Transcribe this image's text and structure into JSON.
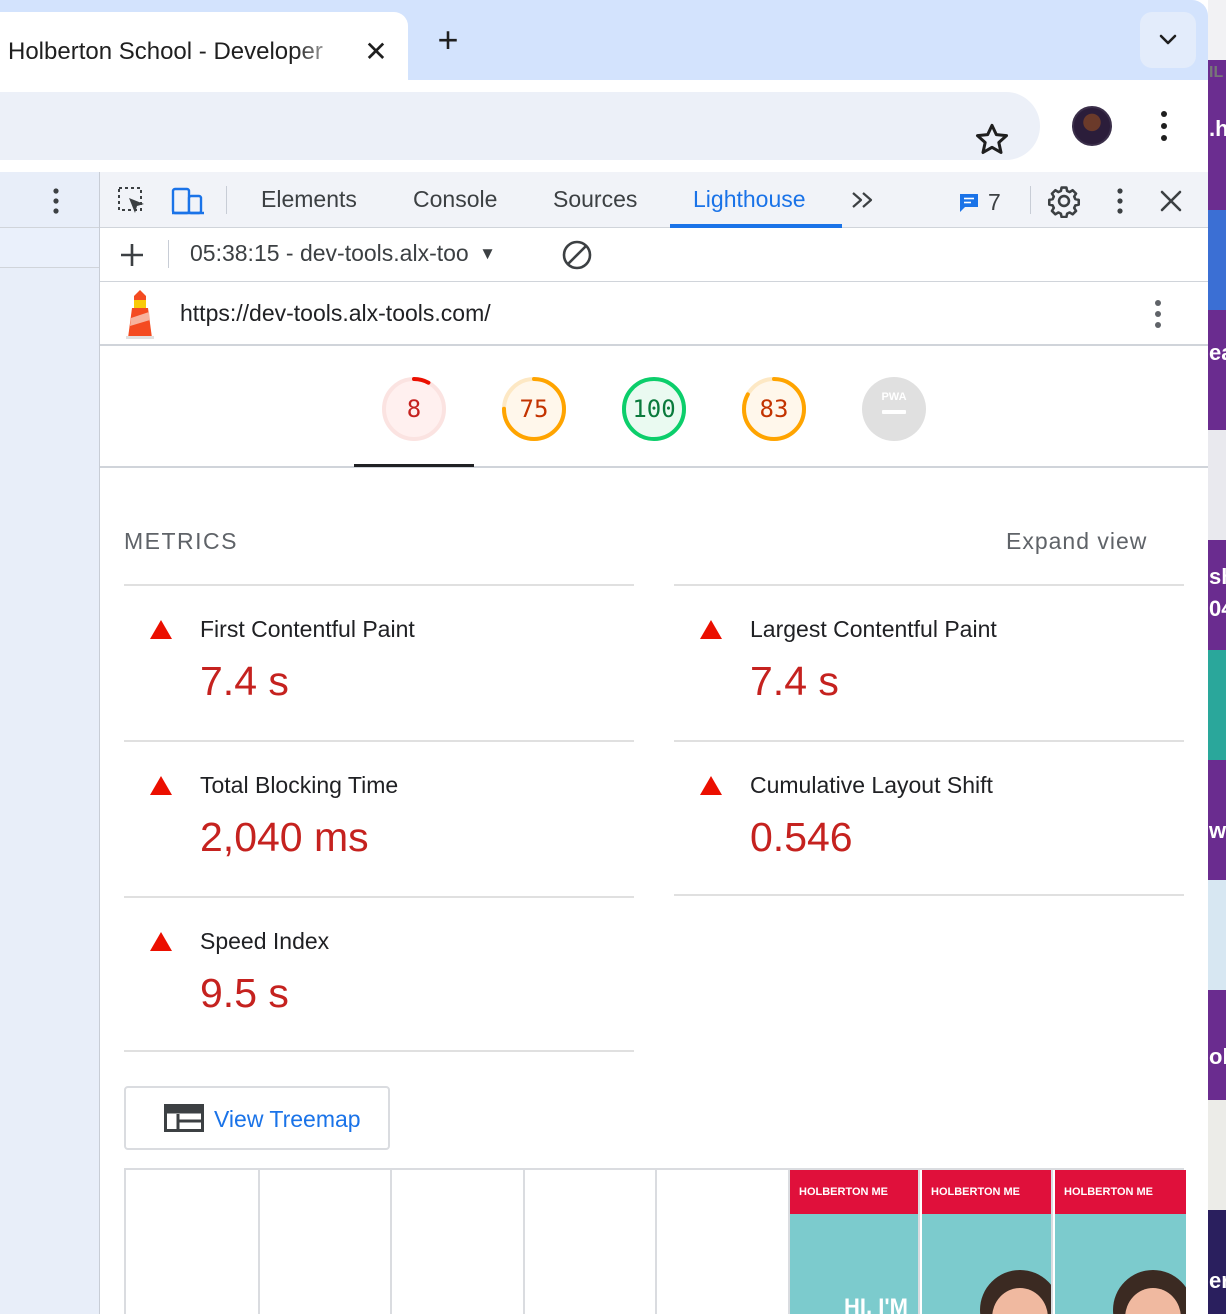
{
  "browser": {
    "tab_title": "Holberton School - Developer",
    "new_tab_symbol": "+",
    "close_symbol": "✕"
  },
  "devtools": {
    "tabs": [
      "Elements",
      "Console",
      "Sources",
      "Lighthouse"
    ],
    "active_tab": "Lighthouse",
    "more_tabs_symbol": "»",
    "issues_count": "7",
    "report_selector": "05:38:15 - dev-tools.alx-too",
    "report_url": "https://dev-tools.alx-tools.com/"
  },
  "scores": [
    {
      "label": "8",
      "value": 8,
      "color": "#eb0f00",
      "bg": "#fff0ef",
      "track": "#fbe3e1"
    },
    {
      "label": "75",
      "value": 75,
      "color": "#ffa400",
      "bg": "#fff7eb",
      "track": "#fde8c4"
    },
    {
      "label": "100",
      "value": 100,
      "color": "#0cce6b",
      "bg": "#eafaf1",
      "track": "#cdf3de"
    },
    {
      "label": "83",
      "value": 83,
      "color": "#ffa400",
      "bg": "#fff7eb",
      "track": "#fde8c4"
    },
    {
      "label": "PWA",
      "value": null,
      "color": "#9e9e9e",
      "bg": "#e0e0e0",
      "track": "#e0e0e0"
    }
  ],
  "score_text_colors": [
    "#c5221f",
    "#c33300",
    "#0a7a3c",
    "#c33300"
  ],
  "metrics_section": {
    "title": "METRICS",
    "expand_label": "Expand view",
    "items": [
      {
        "name": "First Contentful Paint",
        "value": "7.4 s"
      },
      {
        "name": "Largest Contentful Paint",
        "value": "7.4 s"
      },
      {
        "name": "Total Blocking Time",
        "value": "2,040 ms"
      },
      {
        "name": "Cumulative Layout Shift",
        "value": "0.546"
      },
      {
        "name": "Speed Index",
        "value": "9.5 s"
      }
    ],
    "fail_color": "#eb0f00"
  },
  "treemap_button": {
    "label": "View Treemap"
  },
  "filmstrip": {
    "header_text": "HOLBERTON ME",
    "greeting_text": "HI, I'M"
  },
  "background_strip": {
    "fragments": [
      "IL",
      ".h",
      "ea",
      "sh",
      "04",
      "wi",
      "ol",
      "er"
    ]
  }
}
